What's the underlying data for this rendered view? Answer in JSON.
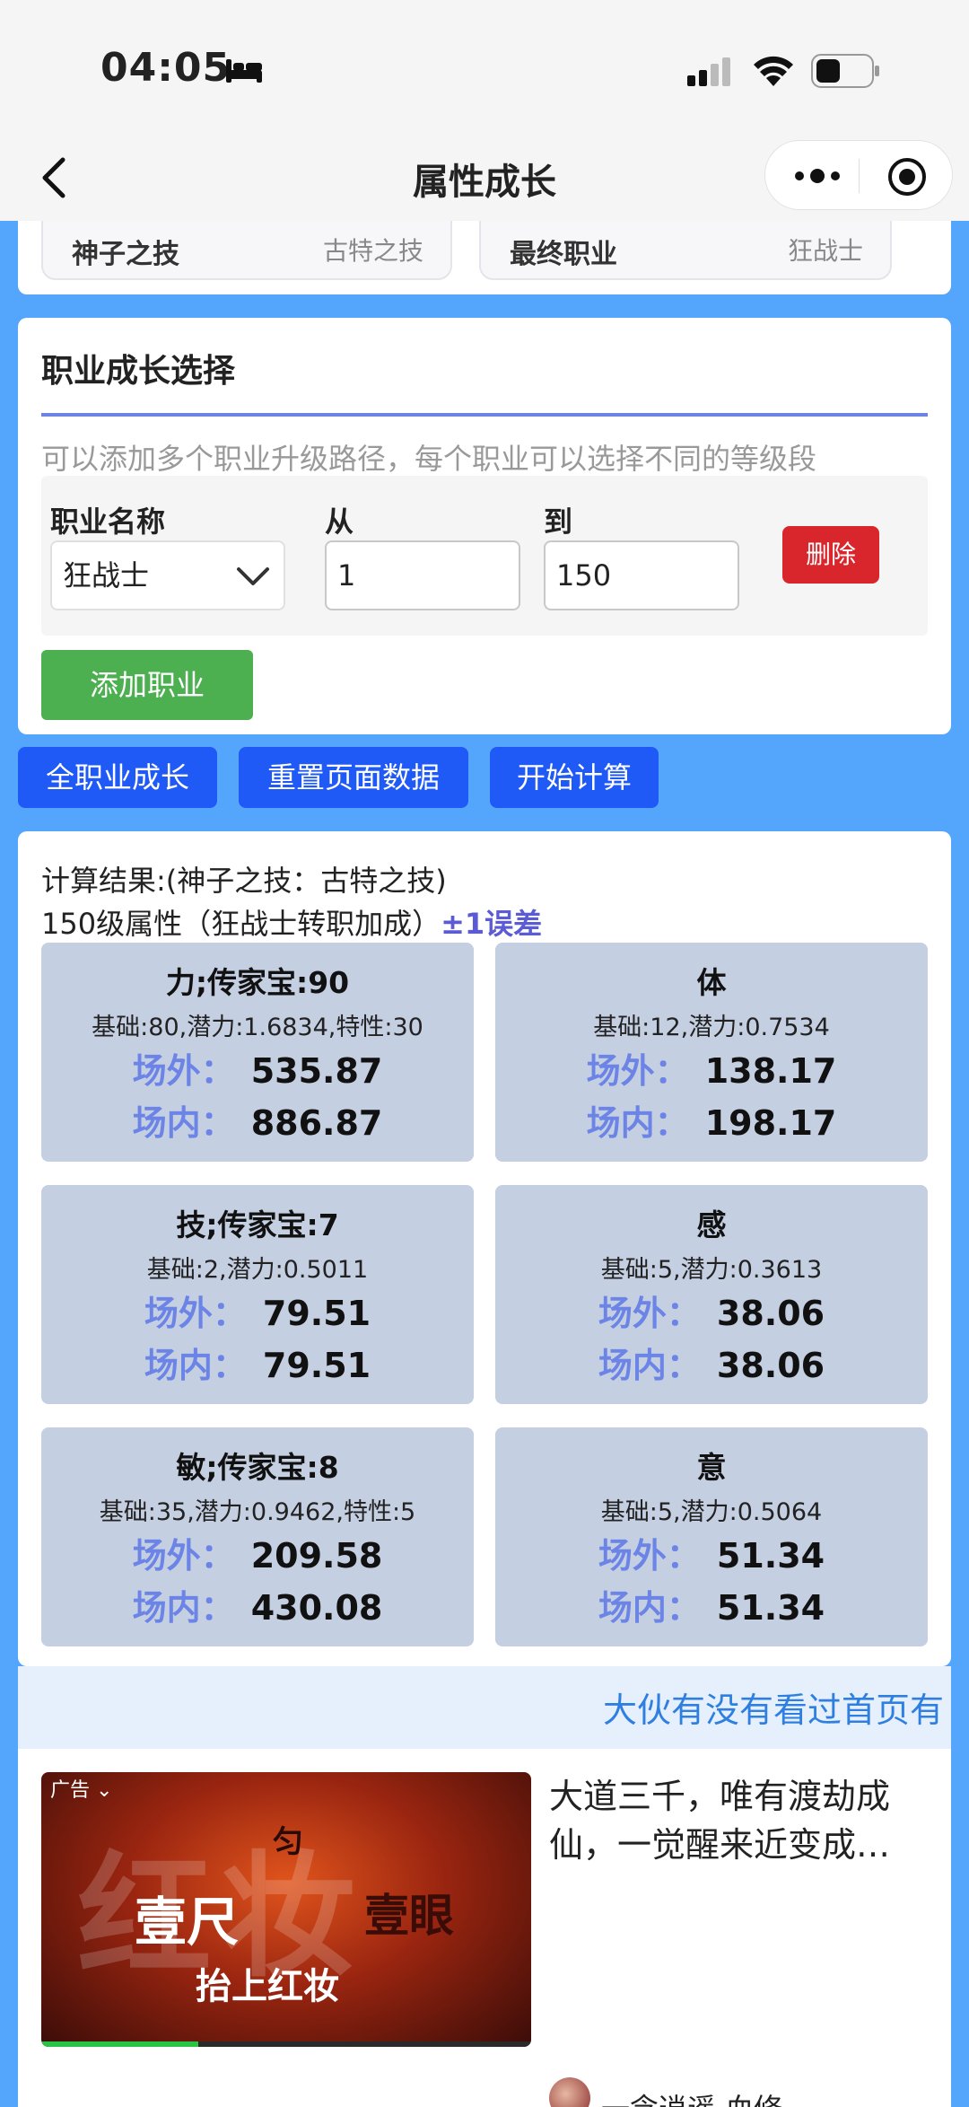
{
  "status_bar": {
    "time": "04:05",
    "battery_level": 0.45
  },
  "nav": {
    "title": "属性成长"
  },
  "top_card": {
    "items": [
      {
        "key": "神子之技",
        "value": "古特之技"
      },
      {
        "key": "最终职业",
        "value": "狂战士"
      }
    ]
  },
  "job_growth": {
    "title": "职业成长选择",
    "hint": "可以添加多个职业升级路径，每个职业可以选择不同的等级段",
    "job_label": "职业名称",
    "job_value": "狂战士",
    "from_label": "从",
    "from_value": "1",
    "to_label": "到",
    "to_value": "150",
    "delete_label": "删除",
    "add_label": "添加职业"
  },
  "actions": {
    "all_growth": "全职业成长",
    "reset": "重置页面数据",
    "calculate": "开始计算"
  },
  "result": {
    "line1": "计算结果:(神子之技：古特之技)",
    "line2": "150级属性（狂战士转职加成）",
    "error_note": "±1误差",
    "out_label": "场外：",
    "in_label": "场内：",
    "stats": [
      {
        "title": "力;传家宝:90",
        "sub": "基础:80,潜力:1.6834,特性:30",
        "out": "535.87",
        "in": "886.87"
      },
      {
        "title": "体",
        "sub": "基础:12,潜力:0.7534",
        "out": "138.17",
        "in": "198.17"
      },
      {
        "title": "技;传家宝:7",
        "sub": "基础:2,潜力:0.5011",
        "out": "79.51",
        "in": "79.51"
      },
      {
        "title": "感",
        "sub": "基础:5,潜力:0.3613",
        "out": "38.06",
        "in": "38.06"
      },
      {
        "title": "敏;传家宝:8",
        "sub": "基础:35,潜力:0.9462,特性:5",
        "out": "209.58",
        "in": "430.08"
      },
      {
        "title": "意",
        "sub": "基础:5,潜力:0.5064",
        "out": "51.34",
        "in": "51.34"
      }
    ]
  },
  "marquee": {
    "text": "大伙有没有看过首页有"
  },
  "ad": {
    "tag": "广告",
    "image_text_top": "匀",
    "image_text_left": "壹尺",
    "image_text_right": "壹眼",
    "image_text_bottom": "抬上红妆",
    "image_watermark": "红妆",
    "progress": 0.32,
    "description": "大道三千，唯有渡劫成仙，一觉醒来近变成…",
    "author": "一念逍遥·血修"
  }
}
